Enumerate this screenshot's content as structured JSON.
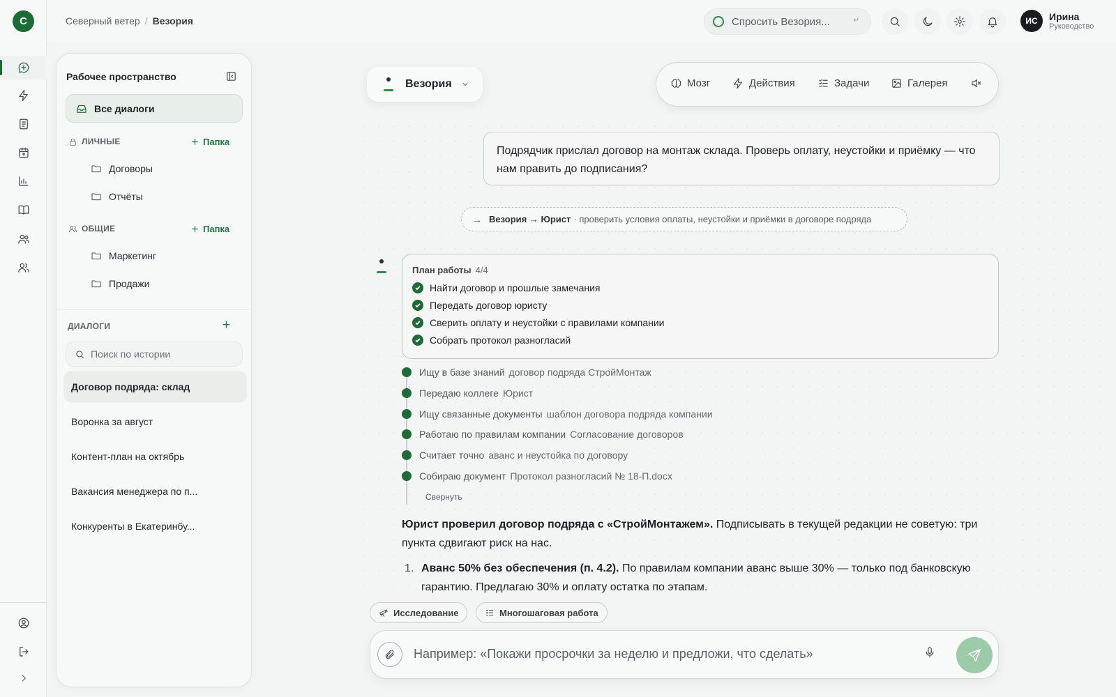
{
  "brand": {
    "logo_letter": "С"
  },
  "breadcrumb": {
    "org": "Северный ветер",
    "separator": "/",
    "current": "Везория"
  },
  "header": {
    "ask_placeholder": "Спросить Везория...",
    "ask_shortcut": "↵",
    "user": {
      "initials": "ИС",
      "name": "Ирина",
      "role": "Руководство"
    }
  },
  "rail": {
    "items": [
      "chat-icon",
      "lightning-icon",
      "document-icon",
      "calendar-icon",
      "chart-icon",
      "book-icon",
      "users-icon",
      "team-icon"
    ],
    "bottom": [
      "profile-icon",
      "logout-icon",
      "expand-icon"
    ]
  },
  "workspace": {
    "title": "Рабочее пространство",
    "all_dialogs": "Все диалоги",
    "personal": {
      "label": "ЛИЧНЫЕ",
      "add": "Папка",
      "folders": [
        "Договоры",
        "Отчёты"
      ]
    },
    "shared": {
      "label": "ОБЩИЕ",
      "add": "Папка",
      "folders": [
        "Маркетинг",
        "Продажи"
      ]
    },
    "dialogs_label": "ДИАЛОГИ",
    "search_placeholder": "Поиск по истории",
    "history": [
      "Договор подряда: склад",
      "Воронка за август",
      "Контент-план на октябрь",
      "Вакансия менеджера по п...",
      "Конкуренты в Екатеринбу..."
    ]
  },
  "assistant": {
    "name": "Везория"
  },
  "toolbar": {
    "brain": "Мозг",
    "actions": "Действия",
    "tasks": "Задачи",
    "gallery": "Галерея"
  },
  "chat": {
    "user_message": "Подрядчик прислал договор на монтаж склада. Проверь оплату, неустойки и приёмку — что нам править до подписания?",
    "handoff": {
      "route": "Везория → Юрист",
      "text": "· проверить условия оплаты, неустойки и приёмки в договоре подряда"
    },
    "plan": {
      "title": "План работы",
      "count": "4/4",
      "steps": [
        "Найти договор и прошлые замечания",
        "Передать договор юристу",
        "Сверить оплату и неустойки с правилами компании",
        "Собрать протокол разногласий"
      ]
    },
    "activity": [
      {
        "action": "Ищу в базе знаний",
        "detail": "договор подряда СтройМонтаж"
      },
      {
        "action": "Передаю коллеге",
        "detail": "Юрист"
      },
      {
        "action": "Ищу связанные документы",
        "detail": "шаблон договора подряда компании"
      },
      {
        "action": "Работаю по правилам компании",
        "detail": "Согласование договоров"
      },
      {
        "action": "Считает точно",
        "detail": "аванс и неустойка по договору"
      },
      {
        "action": "Собираю документ",
        "detail": "Протокол разногласий № 18-П.docx"
      }
    ],
    "collapse_label": "Свернуть",
    "answer": {
      "lead_bold": "Юрист проверил договор подряда с «СтройМонтажем».",
      "lead_rest": " Подписывать в текущей редакции не советую: три пункта сдвигают риск на нас.",
      "items": [
        {
          "num": "1.",
          "bold": "Аванс 50% без обеспечения (п. 4.2).",
          "rest": " По правилам компании аванс выше 30% — только под банковскую гарантию. Предлагаю 30% и оплату остатка по этапам."
        }
      ]
    }
  },
  "composer": {
    "chips": [
      "Исследование",
      "Многошаговая работа"
    ],
    "placeholder": "Например: «Покажи просрочки за неделю и предложи, что сделать»"
  }
}
